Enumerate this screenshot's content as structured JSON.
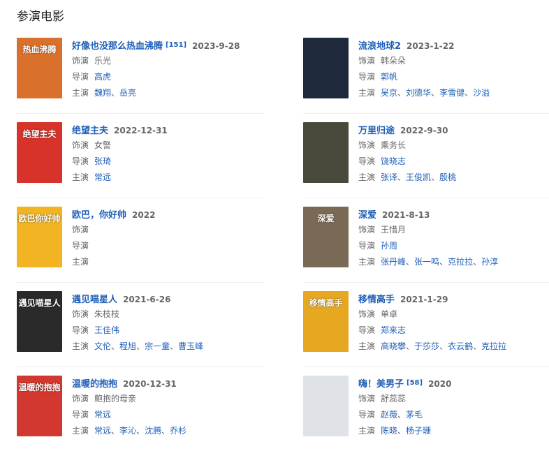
{
  "section_title": "参演电影",
  "labels": {
    "role": "饰演",
    "director": "导演",
    "stars": "主演"
  },
  "films": [
    {
      "title": "好像也没那么热血沸腾",
      "sup": "[151]",
      "date": "2023-9-28",
      "role": "乐光",
      "director": [
        "高虎"
      ],
      "stars": [
        "魏翔",
        "岳亮"
      ],
      "poster_color": "#d9702b",
      "poster_text": "热血沸腾"
    },
    {
      "title": "流浪地球2",
      "sup": "",
      "date": "2023-1-22",
      "role": "韩朵朵",
      "director": [
        "郭帆"
      ],
      "stars": [
        "吴京",
        "刘德华",
        "李雪健",
        "沙溢"
      ],
      "poster_color": "#1e2a3c",
      "poster_text": ""
    },
    {
      "title": "绝望主夫",
      "sup": "",
      "date": "2022-12-31",
      "role": "女警",
      "director": [
        "张琦"
      ],
      "stars": [
        "常远"
      ],
      "poster_color": "#d7332b",
      "poster_text": "绝望主夫"
    },
    {
      "title": "万里归途",
      "sup": "",
      "date": "2022-9-30",
      "role": "乘务长",
      "director": [
        "饶晓志"
      ],
      "stars": [
        "张译",
        "王俊凯",
        "殷桃"
      ],
      "poster_color": "#4a4a3c",
      "poster_text": ""
    },
    {
      "title": "欧巴，你好帅",
      "sup": "",
      "date": "2022",
      "role": "",
      "director": [],
      "stars": [],
      "poster_color": "#f2b423",
      "poster_text": "欧巴你好帅"
    },
    {
      "title": "深爱",
      "sup": "",
      "date": "2021-8-13",
      "role": "王惜月",
      "director": [
        "孙周"
      ],
      "stars": [
        "张丹峰",
        "张一鸣",
        "克拉拉",
        "孙淳"
      ],
      "poster_color": "#7a6a55",
      "poster_text": "深爱"
    },
    {
      "title": "遇见喵星人",
      "sup": "",
      "date": "2021-6-26",
      "role": "朱枝枝",
      "director": [
        "王佳伟"
      ],
      "stars": [
        "文伦",
        "程旭",
        "宗一童",
        "曹玉峰"
      ],
      "poster_color": "#2a2a2a",
      "poster_text": "遇见喵星人"
    },
    {
      "title": "移情高手",
      "sup": "",
      "date": "2021-1-29",
      "role": "单卓",
      "director": [
        "郑来志"
      ],
      "stars": [
        "高晓攀",
        "于莎莎",
        "衣云鹤",
        "克拉拉"
      ],
      "poster_color": "#e7a821",
      "poster_text": "移情高手"
    },
    {
      "title": "温暖的抱抱",
      "sup": "",
      "date": "2020-12-31",
      "role": "鲍抱的母亲",
      "director": [
        "常远"
      ],
      "stars": [
        "常远",
        "李沁",
        "沈腾",
        "乔杉"
      ],
      "poster_color": "#d2382f",
      "poster_text": "温暖的抱抱"
    },
    {
      "title": "嗨！美男子",
      "sup": "[58]",
      "date": "2020",
      "role": "舒蕊蕊",
      "director": [
        "赵薇",
        "茅毛"
      ],
      "stars": [
        "陈晓",
        "杨子珊"
      ],
      "poster_color": "#dfe3e8",
      "poster_text": ""
    }
  ]
}
